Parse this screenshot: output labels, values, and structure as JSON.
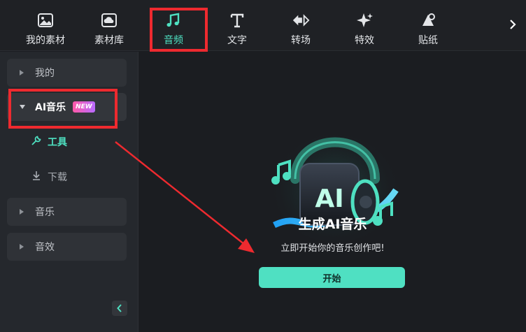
{
  "toolbar": {
    "items": [
      {
        "label": "我的素材",
        "icon": "image-icon"
      },
      {
        "label": "素材库",
        "icon": "cloud-library-icon"
      },
      {
        "label": "音频",
        "icon": "music-note-icon",
        "active": true
      },
      {
        "label": "文字",
        "icon": "text-t-icon"
      },
      {
        "label": "转场",
        "icon": "transition-icon"
      },
      {
        "label": "特效",
        "icon": "sparkle-effects-icon"
      },
      {
        "label": "贴纸",
        "icon": "sticker-icon"
      }
    ],
    "next_icon": "chevron-right-icon"
  },
  "sidebar": {
    "items": [
      {
        "label": "我的"
      },
      {
        "label": "AI音乐",
        "badge": "NEW",
        "expanded": true
      },
      {
        "label": "音乐"
      },
      {
        "label": "音效"
      }
    ],
    "subitems": [
      {
        "label": "工具",
        "icon": "wrench-icon",
        "active": true
      },
      {
        "label": "下载",
        "icon": "download-icon"
      }
    ],
    "collapse_icon": "chevron-left-icon"
  },
  "main": {
    "title": "生成AI音乐",
    "subtitle": "立即开始你的音乐创作吧!",
    "start_label": "开始",
    "hero_text": "AI"
  },
  "colors": {
    "accent": "#4ee0c1",
    "annotation": "#ee2a2f",
    "badge_from": "#ff5aa8",
    "badge_to": "#b96bff"
  }
}
